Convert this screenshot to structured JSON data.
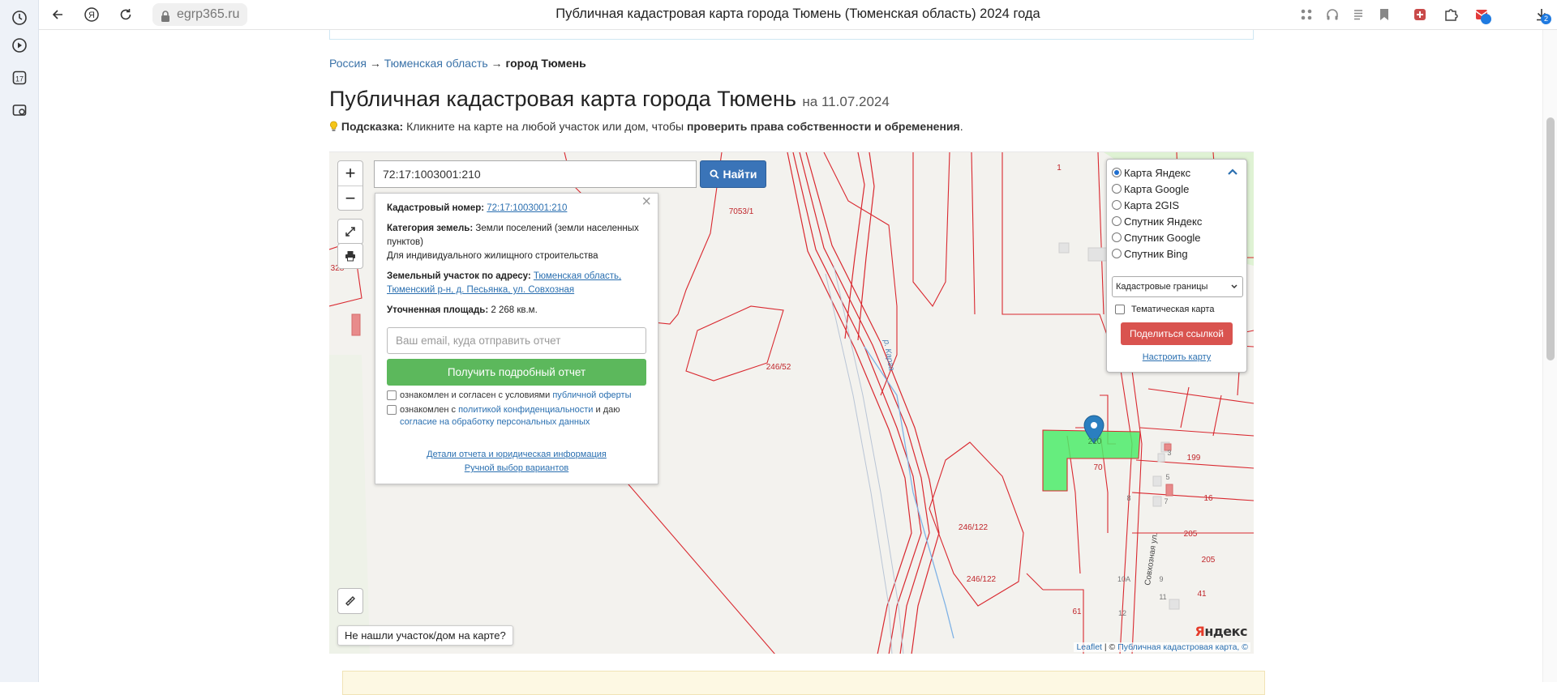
{
  "browser": {
    "url": "egrp365.ru",
    "title": "Публичная кадастровая карта города Тюмень (Тюменская область) 2024 года",
    "sidebar_badge": "17",
    "download_badge": "2"
  },
  "breadcrumb": {
    "items": [
      "Россия",
      "Тюменская область"
    ],
    "separator": "→",
    "current": "город Тюмень"
  },
  "page": {
    "title": "Публичная кадастровая карта города Тюмень",
    "date": "на 11.07.2024",
    "hint_label": "Подсказка:",
    "hint_text": " Кликните на карте на любой участок или дом, чтобы ",
    "hint_bold": "проверить права собственности и обременения",
    "hint_end": "."
  },
  "map": {
    "zoom_in": "+",
    "zoom_out": "−",
    "search_value": "72:17:1003001:210",
    "find_label": "Найти",
    "not_found": "Не нашли участок/дом на карте?",
    "attribution_link": "Leaflet",
    "attribution_sep": " | © ",
    "attribution_text": "Публичная кадастровая карта, ©",
    "yandex_logo": "ндекс",
    "yandex_first": "Я",
    "labels": {
      "l1": "1",
      "l7053": "7053/1",
      "l328": "328",
      "l246_52": "246/52",
      "l210": "210",
      "l70": "70",
      "l8": "8",
      "l85": "85",
      "l199": "199",
      "l16": "16",
      "l205a": "205",
      "l205b": "205",
      "l246_122a": "246/122",
      "l246_122b": "246/122",
      "l10a": "10А",
      "l9": "9",
      "l11": "11",
      "l12": "12",
      "l41": "41",
      "l61": "61",
      "l5": "5",
      "l7": "7",
      "l3": "3",
      "river": "р. Карга",
      "street": "Совхозная ул."
    }
  },
  "popup": {
    "cad_label": "Кадастровый номер:",
    "cad_value": "72:17:1003001:210",
    "cat_label": "Категория земель:",
    "cat_value": "Земли поселений (земли населенных пунктов)",
    "use": "Для индивидуального жилищного строительства",
    "addr_label": "Земельный участок по адресу:",
    "addr_value": "Тюменская область, Тюменский р-н, д. Песьянка, ул. Совхозная",
    "area_label": "Уточненная площадь:",
    "area_value": "2 268",
    "area_unit": "кв.м.",
    "email_placeholder": "Ваш email, куда отправить отчет",
    "report_button": "Получить подробный отчет",
    "agree1_text": "ознакомлен и согласен с условиями ",
    "agree1_link": "публичной оферты",
    "agree2_text": "ознакомлен с ",
    "agree2_link": "политикой конфиденциальности",
    "agree2_mid": " и даю ",
    "agree2_link2": "согласие на обработку персональных данных",
    "details_link": "Детали отчета и юридическая информация",
    "manual_link": "Ручной выбор вариантов"
  },
  "layers": {
    "options": [
      "Карта Яндекс",
      "Карта Google",
      "Карта 2GIS",
      "Спутник Яндекс",
      "Спутник Google",
      "Спутник Bing"
    ],
    "selected": 0,
    "select_value": "Кадастровые границы",
    "thematic_label": "Тематическая карта",
    "share_button": "Поделиться ссылкой",
    "setup_link": "Настроить карту"
  },
  "colors": {
    "accent": "#3a74b8",
    "success": "#5cb85c",
    "danger": "#d9534f",
    "parcel_line": "#d9282f",
    "highlight": "#4cec6a"
  }
}
